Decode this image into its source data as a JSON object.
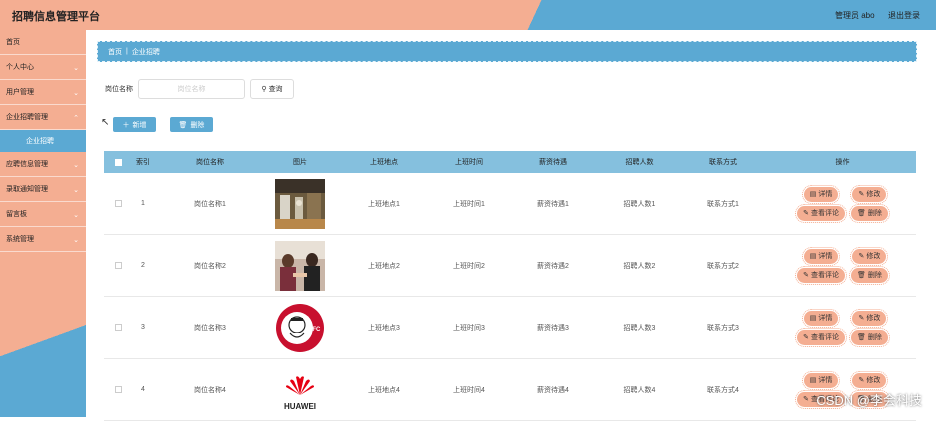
{
  "app": {
    "title": "招聘信息管理平台",
    "user_label": "管理员 abo",
    "logout_label": "退出登录"
  },
  "sidebar": {
    "items": [
      {
        "label": "首页",
        "chevron": false
      },
      {
        "label": "个人中心",
        "chevron": true
      },
      {
        "label": "用户管理",
        "chevron": true
      },
      {
        "label": "企业招聘管理",
        "chevron": true
      },
      {
        "label": "应聘信息管理",
        "chevron": true
      },
      {
        "label": "录取通知管理",
        "chevron": true
      },
      {
        "label": "留言板",
        "chevron": true
      },
      {
        "label": "系统管理",
        "chevron": true
      }
    ],
    "active_sub": "企业招聘"
  },
  "breadcrumb": {
    "home": "首页",
    "current": "企业招聘"
  },
  "search": {
    "label": "岗位名称",
    "placeholder": "岗位名称",
    "button": "查询"
  },
  "toolbar": {
    "add": "新增",
    "delete": "删除"
  },
  "table": {
    "headers": [
      "索引",
      "岗位名称",
      "图片",
      "上班地点",
      "上班时间",
      "薪资待遇",
      "招聘人数",
      "联系方式",
      "操作"
    ],
    "rows": [
      {
        "index": "1",
        "name": "岗位名称1",
        "image": "office-photo",
        "place": "上班地点1",
        "time": "上班时间1",
        "salary": "薪资待遇1",
        "count": "招聘人数1",
        "contact": "联系方式1"
      },
      {
        "index": "2",
        "name": "岗位名称2",
        "image": "handshake-photo",
        "place": "上班地点2",
        "time": "上班时间2",
        "salary": "薪资待遇2",
        "count": "招聘人数2",
        "contact": "联系方式2"
      },
      {
        "index": "3",
        "name": "岗位名称3",
        "image": "kfc-logo",
        "place": "上班地点3",
        "time": "上班时间3",
        "salary": "薪资待遇3",
        "count": "招聘人数3",
        "contact": "联系方式3"
      },
      {
        "index": "4",
        "name": "岗位名称4",
        "image": "huawei-logo",
        "place": "上班地点4",
        "time": "上班时间4",
        "salary": "薪资待遇4",
        "count": "招聘人数4",
        "contact": "联系方式4"
      }
    ],
    "actions": {
      "detail": "详情",
      "edit": "修改",
      "review": "查看评论",
      "delete": "删除"
    }
  },
  "logos": {
    "kfc": "KFC",
    "huawei": "HUAWEI"
  },
  "watermark": "CSDN @李会科技",
  "colors": {
    "peach": "#f4ae92",
    "blue": "#5ba9d3",
    "header_blue": "#85c0de"
  }
}
